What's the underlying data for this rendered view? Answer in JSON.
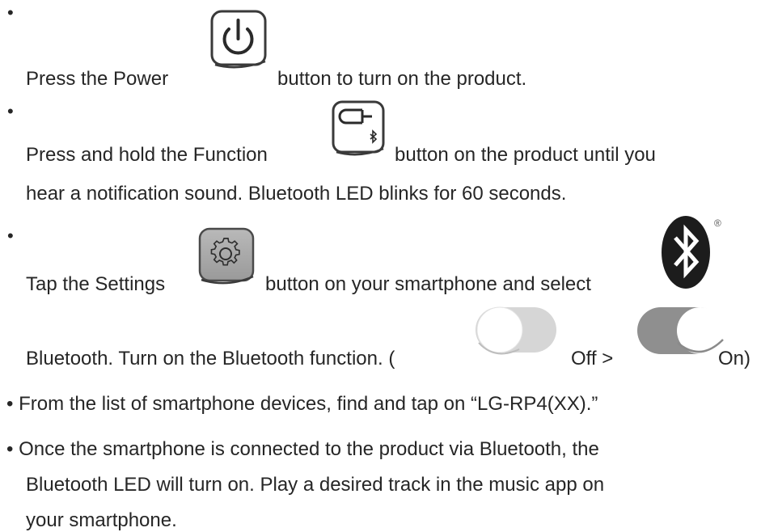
{
  "instructions": {
    "step1": {
      "bullet": "•",
      "before": "Press the Power",
      "after": "button to turn on the product."
    },
    "step2": {
      "bullet": "•",
      "before": "Press and hold the Function",
      "after": "button on the product until you",
      "line2": "hear a notification sound. Bluetooth LED blinks for 60 seconds."
    },
    "step3": {
      "bullet": "•",
      "before": "Tap the Settings",
      "after": "button on your smartphone and select",
      "line2a": "Bluetooth. Turn on the Bluetooth function. (",
      "off": "Off >",
      "on": "On)"
    },
    "step4": "• From the list of smartphone devices, find and tap on “LG-RP4(XX).”",
    "step5": {
      "line1": "• Once the smartphone is connected to the product via Bluetooth, the",
      "line2": "Bluetooth LED will turn on. Play a desired track in the music app on",
      "line3": "your smartphone."
    }
  },
  "icons": {
    "power": "power-icon",
    "function": "function-bluetooth-icon",
    "settings": "settings-gear-icon",
    "bluetooth": "bluetooth-logo-icon",
    "toggle_off": "toggle-off-icon",
    "toggle_on": "toggle-on-icon"
  },
  "bluetooth_logo_mark": "®"
}
